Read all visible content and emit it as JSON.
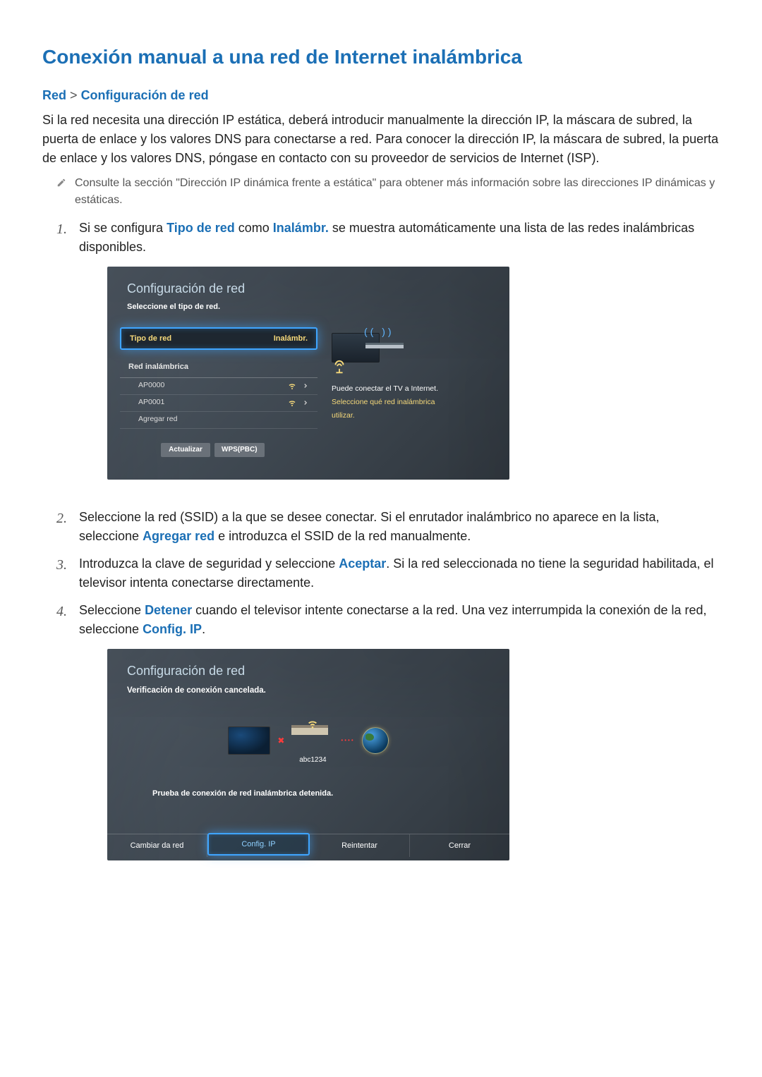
{
  "title": "Conexión manual a una red de Internet inalámbrica",
  "breadcrumb": {
    "a": "Red",
    "sep": ">",
    "b": "Configuración de red"
  },
  "intro": "Si la red necesita una dirección IP estática, deberá introducir manualmente la dirección IP, la máscara de subred, la puerta de enlace y los valores DNS para conectarse a red. Para conocer la dirección IP, la máscara de subred, la puerta de enlace y los valores DNS, póngase en contacto con su proveedor de servicios de Internet (ISP).",
  "note": "Consulte la sección \"Dirección IP dinámica frente a estática\" para obtener más información sobre las direcciones IP dinámicas y estáticas.",
  "steps": {
    "s1_pre": "Si se configura ",
    "s1_b1": "Tipo de red",
    "s1_mid": " como ",
    "s1_b2": "Inalámbr.",
    "s1_post": " se muestra automáticamente una lista de las redes inalámbricas disponibles.",
    "s2_pre": "Seleccione la red (SSID) a la que se desee conectar. Si el enrutador inalámbrico no aparece en la lista, seleccione ",
    "s2_b": "Agregar red",
    "s2_post": " e introduzca el SSID de la red manualmente.",
    "s3_pre": "Introduzca la clave de seguridad y seleccione ",
    "s3_b": "Aceptar",
    "s3_post": ". Si la red seleccionada no tiene la seguridad habilitada, el televisor intenta conectarse directamente.",
    "s4_pre": "Seleccione ",
    "s4_b1": "Detener",
    "s4_mid": " cuando el televisor intente conectarse a la red. Una vez interrumpida la conexión de la red, seleccione ",
    "s4_b2": "Config. IP",
    "s4_post": "."
  },
  "panel1": {
    "title": "Configuración de red",
    "subtitle": "Seleccione el tipo de red.",
    "tipo_label": "Tipo de red",
    "tipo_value": "Inalámbr.",
    "red_label": "Red inalámbrica",
    "aps": [
      "AP0000",
      "AP0001"
    ],
    "agregar": "Agregar red",
    "btn_refresh": "Actualizar",
    "btn_wps": "WPS(PBC)",
    "right_line1": "Puede conectar el TV a Internet.",
    "right_line2": "Seleccione qué red inalámbrica",
    "right_line3": "utilizar.",
    "wifi_arc_glyph": "((     ))"
  },
  "panel2": {
    "title": "Configuración de red",
    "subtitle": "Verificación de conexión cancelada.",
    "ssid": "abc1234",
    "msg": "Prueba de conexión de red inalámbrica detenida.",
    "btns": [
      "Cambiar da red",
      "Config. IP",
      "Reintentar",
      "Cerrar"
    ],
    "x_glyph": "✖",
    "dots_glyph": "••••"
  }
}
